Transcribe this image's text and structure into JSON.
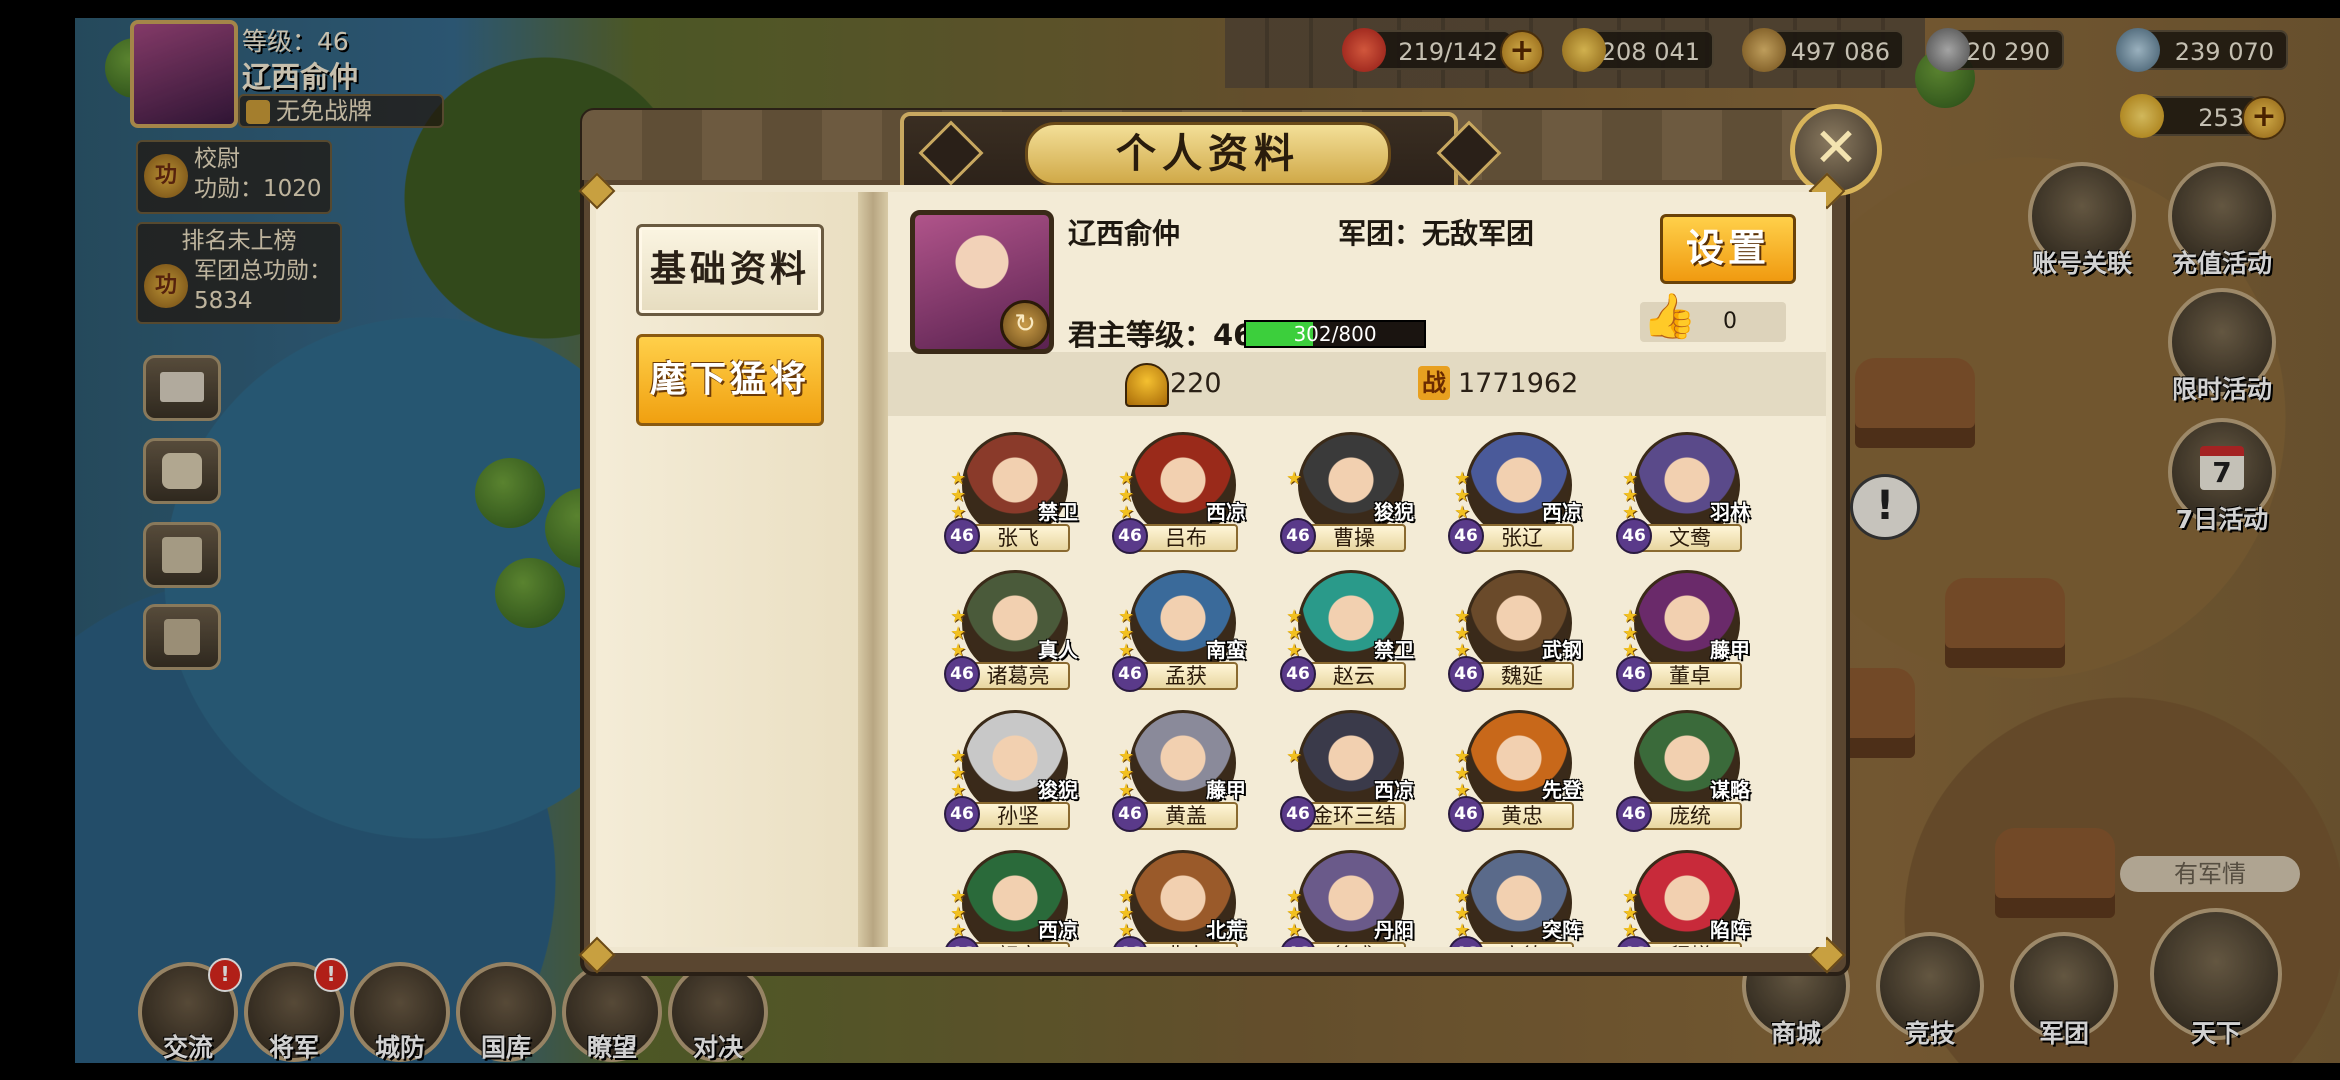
{
  "player": {
    "level_label": "等级：46",
    "name": "辽西俞仲",
    "card_status": "无免战牌",
    "rank_title": "校尉",
    "merit": "功勋：1020",
    "rank_status": "排名未上榜",
    "legion_merit_label": "军团总功勋：",
    "legion_merit_value": "5834"
  },
  "resources": {
    "stamina": "219/142",
    "coins": "208 041",
    "food": "497 086",
    "iron": "20 290",
    "stone": "239 070",
    "gold": "253"
  },
  "bottom_menu": [
    {
      "label": "交流",
      "alert": "!"
    },
    {
      "label": "将军",
      "alert": "!"
    },
    {
      "label": "城防",
      "alert": ""
    },
    {
      "label": "国库",
      "alert": ""
    },
    {
      "label": "瞭望",
      "alert": ""
    },
    {
      "label": "对决",
      "alert": ""
    }
  ],
  "bottom_right_menu": [
    "商城",
    "竞技",
    "军团",
    "天下"
  ],
  "right_menu": [
    "账号关联",
    "充值活动",
    "限时活动",
    "7日活动"
  ],
  "calendar_number": "7",
  "news_label": "有军情",
  "dialog": {
    "title": "个人资料",
    "close_icon": "✕",
    "tabs": [
      "基础资料",
      "麾下猛将"
    ],
    "active_tab": 1,
    "profile": {
      "name": "辽西俞仲",
      "legion": "军团：无敌军团",
      "lord_level_label": "君主等级：46",
      "xp_text": "302/800",
      "xp_fraction": 0.3775,
      "settings_label": "设置",
      "likes": "0",
      "heroes_count": "220",
      "battle_power": "1771962",
      "battle_icon_text": "战"
    },
    "heroes": [
      {
        "name": "张飞",
        "tag": "禁卫",
        "level": "46",
        "stars": 3,
        "color": "#8a3a2a"
      },
      {
        "name": "吕布",
        "tag": "西凉",
        "level": "46",
        "stars": 3,
        "color": "#9a2a1a"
      },
      {
        "name": "曹操",
        "tag": "狻猊",
        "level": "46",
        "stars": 1,
        "color": "#3a3a3a"
      },
      {
        "name": "张辽",
        "tag": "西凉",
        "level": "46",
        "stars": 3,
        "color": "#4a5a9a"
      },
      {
        "name": "文鸯",
        "tag": "羽林",
        "level": "46",
        "stars": 3,
        "color": "#5a4a8a"
      },
      {
        "name": "诸葛亮",
        "tag": "真人",
        "level": "46",
        "stars": 3,
        "color": "#4a5a3a"
      },
      {
        "name": "孟获",
        "tag": "南蛮",
        "level": "46",
        "stars": 3,
        "color": "#3a6a9a"
      },
      {
        "name": "赵云",
        "tag": "禁卫",
        "level": "46",
        "stars": 3,
        "color": "#2a9a8a"
      },
      {
        "name": "魏延",
        "tag": "武钢",
        "level": "46",
        "stars": 3,
        "color": "#6a4a2a"
      },
      {
        "name": "董卓",
        "tag": "藤甲",
        "level": "46",
        "stars": 3,
        "color": "#6a2a6a"
      },
      {
        "name": "孙坚",
        "tag": "狻猊",
        "level": "46",
        "stars": 3,
        "color": "#c8c8c8"
      },
      {
        "name": "黄盖",
        "tag": "藤甲",
        "level": "46",
        "stars": 3,
        "color": "#8a8a9a"
      },
      {
        "name": "金环三结",
        "tag": "西凉",
        "level": "46",
        "stars": 1,
        "color": "#3a3a4a"
      },
      {
        "name": "黄忠",
        "tag": "先登",
        "level": "46",
        "stars": 3,
        "color": "#c8681a"
      },
      {
        "name": "庞统",
        "tag": "谋略",
        "level": "46",
        "stars": 0,
        "color": "#3a6a3a"
      },
      {
        "name": "颜良",
        "tag": "西凉",
        "level": "46",
        "stars": 3,
        "color": "#2a6a3a"
      },
      {
        "name": "典韦",
        "tag": "北荒",
        "level": "46",
        "stars": 3,
        "color": "#9a5a2a"
      },
      {
        "name": "徐盛",
        "tag": "丹阳",
        "level": "46",
        "stars": 3,
        "color": "#6a5a8a"
      },
      {
        "name": "庞德",
        "tag": "突阵",
        "level": "46",
        "stars": 3,
        "color": "#5a6a8a"
      },
      {
        "name": "貂蝉",
        "tag": "陷阵",
        "level": "46",
        "stars": 3,
        "color": "#c82a3a"
      }
    ]
  }
}
